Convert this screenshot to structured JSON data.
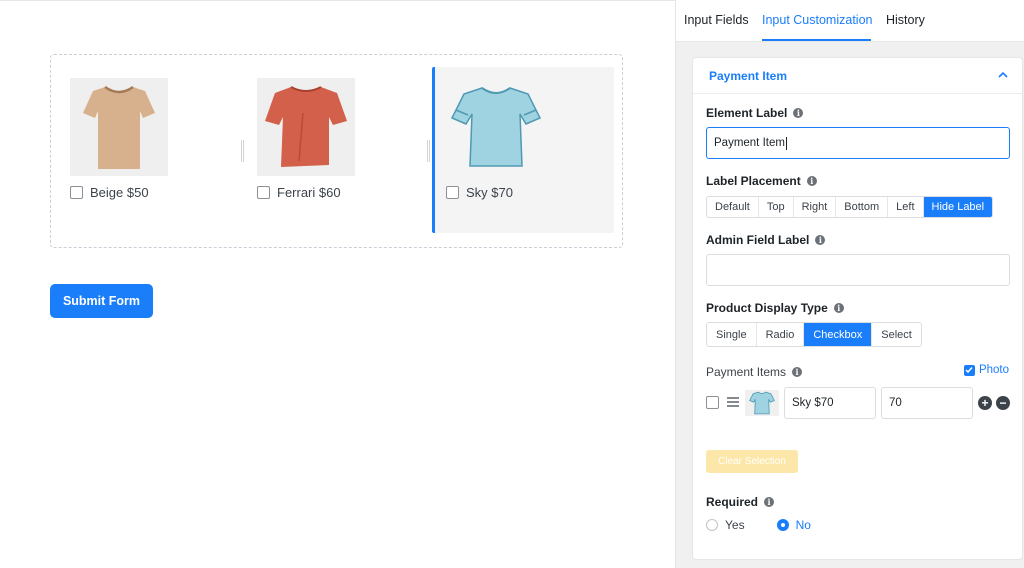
{
  "canvas": {
    "products": [
      {
        "label": "Beige $50",
        "color": "#d7b08d",
        "icon": "tshirt-icon"
      },
      {
        "label": "Ferrari $60",
        "color": "#d2604a",
        "icon": "tshirt-icon"
      },
      {
        "label": "Sky $70",
        "color": "#9fd3e2",
        "icon": "tshirt-icon"
      }
    ],
    "submit_label": "Submit Form"
  },
  "panel": {
    "tabs": [
      {
        "label": "Input Fields",
        "active": false
      },
      {
        "label": "Input Customization",
        "active": true
      },
      {
        "label": "History",
        "active": false
      }
    ],
    "section_title": "Payment Item",
    "element_label": {
      "title": "Element Label",
      "value": "Payment Item"
    },
    "label_placement": {
      "title": "Label Placement",
      "options": [
        "Default",
        "Top",
        "Right",
        "Bottom",
        "Left",
        "Hide Label"
      ],
      "selected": "Hide Label"
    },
    "admin_field_label": {
      "title": "Admin Field Label",
      "value": ""
    },
    "display_type": {
      "title": "Product Display Type",
      "options": [
        "Single",
        "Radio",
        "Checkbox",
        "Select"
      ],
      "selected": "Checkbox"
    },
    "payment_items": {
      "title": "Payment Items",
      "photo_label": "Photo",
      "photo_checked": true,
      "row": {
        "name": "Sky $70",
        "price": "70"
      }
    },
    "clear_label": "Clear Selection",
    "required": {
      "title": "Required",
      "options": [
        "Yes",
        "No"
      ],
      "selected": "No"
    }
  },
  "colors": {
    "accent": "#1a7efb",
    "clear_button": "#fde7a8"
  }
}
